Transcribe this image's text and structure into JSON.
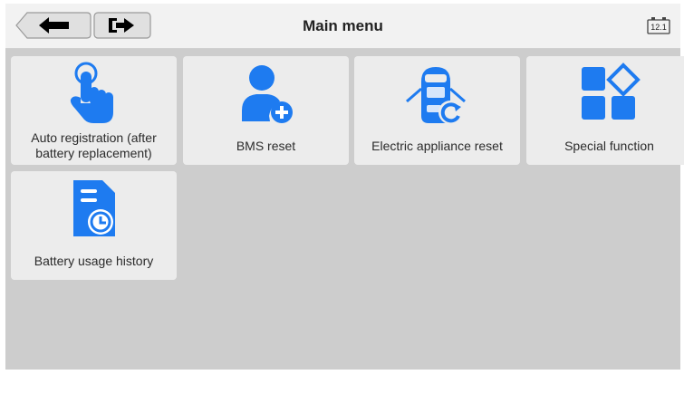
{
  "header": {
    "title": "Main menu",
    "battery_value": "12.1",
    "accent_color": "#1e7bf0"
  },
  "menu": {
    "tiles": [
      {
        "label": "Auto registration (after battery replacement)",
        "icon": "hand-pointer-icon"
      },
      {
        "label": "BMS reset",
        "icon": "user-add-icon"
      },
      {
        "label": "Electric appliance reset",
        "icon": "car-reset-icon"
      },
      {
        "label": "Special function",
        "icon": "apps-grid-icon"
      },
      {
        "label": "Battery usage history",
        "icon": "document-clock-icon"
      }
    ]
  }
}
